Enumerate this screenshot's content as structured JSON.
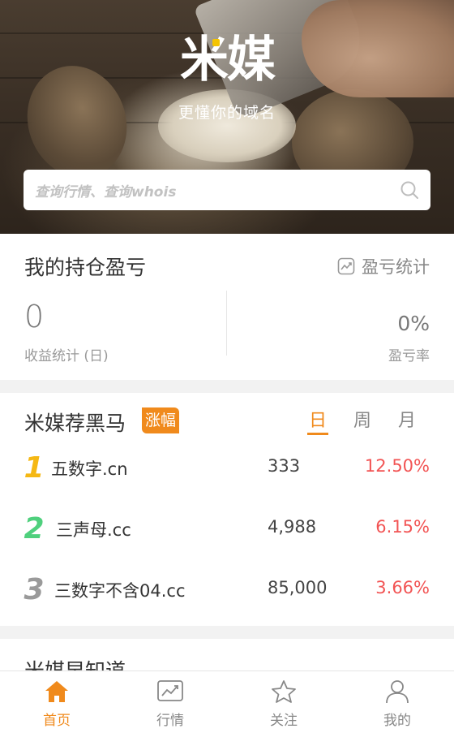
{
  "hero": {
    "logo": "米媒",
    "slogan": "更懂你的域名",
    "search_placeholder": "查询行情、查询whois"
  },
  "holdings": {
    "title": "我的持仓盈亏",
    "stats_link": "盈亏统计",
    "daily_profit_value": "0",
    "daily_profit_label": "收益统计 (日)",
    "rate_value": "0%",
    "rate_label": "盈亏率"
  },
  "darkhorse": {
    "title": "米媒荐黑马",
    "badge": "涨幅",
    "tabs": [
      "日",
      "周",
      "月"
    ],
    "active_tab": "日",
    "rows": [
      {
        "rank": "1",
        "domain": "五数字.cn",
        "price": "333",
        "change": "12.50%",
        "rank_color": "#f5b814"
      },
      {
        "rank": "2",
        "domain": "三声母.cc",
        "price": "4,988",
        "change": "6.15%",
        "rank_color": "#4fd07d"
      },
      {
        "rank": "3",
        "domain": "三数字不含04.cc",
        "price": "85,000",
        "change": "3.66%",
        "rank_color": "#9a9a9a"
      }
    ]
  },
  "knowledge": {
    "title": "米媒早知道"
  },
  "tabbar": {
    "items": [
      "首页",
      "行情",
      "关注",
      "我的"
    ],
    "active": "首页"
  },
  "colors": {
    "accent": "#f08a1c",
    "negative_change": "#f25454"
  }
}
